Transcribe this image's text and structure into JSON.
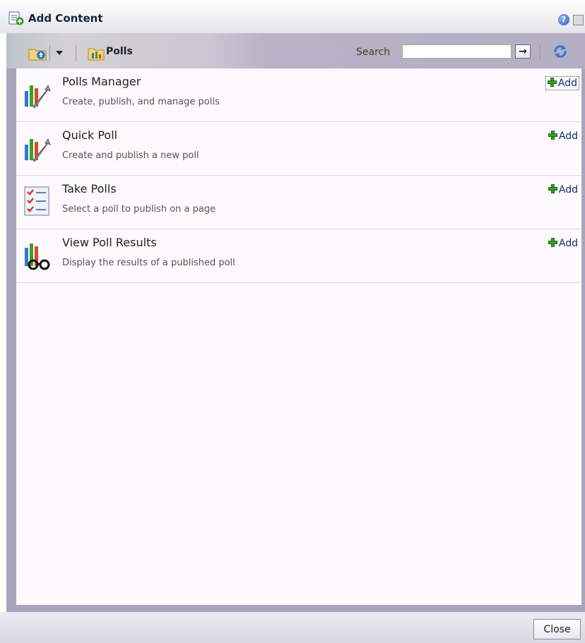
{
  "dialog": {
    "title": "Add Content",
    "help_icon": "help-icon",
    "close_icon": "close-x-icon"
  },
  "toolbar": {
    "folder_label": "Polls",
    "search_label": "Search",
    "search_value": "",
    "go_icon": "arrow-right-icon",
    "refresh_icon": "refresh-icon"
  },
  "items": [
    {
      "title": "Polls Manager",
      "description": "Create, publish, and manage polls",
      "add_label": "Add",
      "icon": "polls-manager-icon"
    },
    {
      "title": "Quick Poll",
      "description": "Create and publish a new poll",
      "add_label": "Add",
      "icon": "quick-poll-icon"
    },
    {
      "title": "Take Polls",
      "description": "Select a poll to publish on a page",
      "add_label": "Add",
      "icon": "take-polls-icon"
    },
    {
      "title": "View Poll Results",
      "description": "Display the results of a published poll",
      "add_label": "Add",
      "icon": "view-results-icon"
    }
  ],
  "footer": {
    "close_label": "Close"
  },
  "colors": {
    "accent": "#aaa5be",
    "link": "#0e2f6e",
    "add_plus": "#3aa02c"
  }
}
